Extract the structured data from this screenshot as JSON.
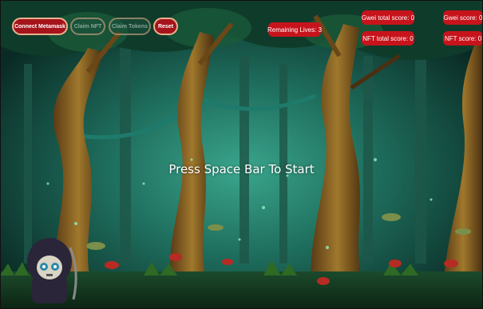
{
  "controls": {
    "connect_label": "Connect Metamask",
    "claim_nft_label": "Claim NFT",
    "claim_tokens_label": "Claim Tokens",
    "reset_label": "Reset"
  },
  "hud": {
    "remaining_lives": "Remaining Lives: 3",
    "gwei_total_score": "Gwei total score: 0",
    "nft_total_score": "NFT total score: 0",
    "gwei_score": "Gwei score: 0",
    "nft_score": "NFT score: 0"
  },
  "message": {
    "start": "Press Space Bar To Start"
  },
  "colors": {
    "button_red": "#a5141b",
    "button_border": "#e9b28d",
    "hud_red": "#c7141c",
    "forest_dark": "#0b2a24",
    "forest_glow": "#2f8f79"
  },
  "icons": {
    "player": "hooded-reaper-character"
  }
}
